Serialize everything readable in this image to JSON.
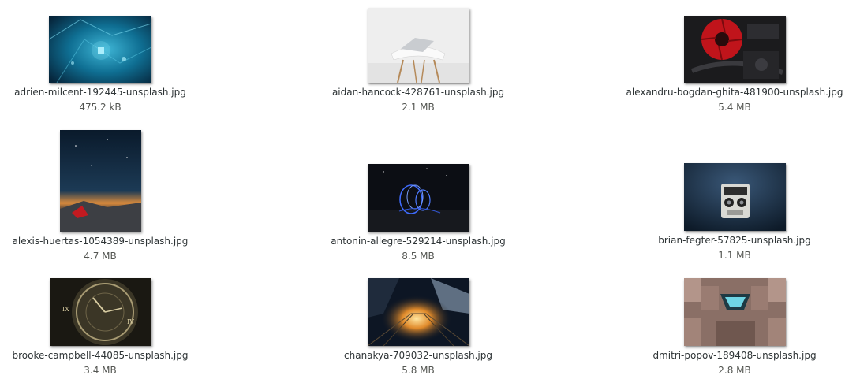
{
  "files": [
    {
      "name": "adrien-milcent-192445-unsplash.jpg",
      "size": "475.2 kB"
    },
    {
      "name": "aidan-hancock-428761-unsplash.jpg",
      "size": "2.1 MB"
    },
    {
      "name": "alexandru-bogdan-ghita-481900-unsplash.jpg",
      "size": "5.4 MB"
    },
    {
      "name": "alexis-huertas-1054389-unsplash.jpg",
      "size": "4.7 MB"
    },
    {
      "name": "antonin-allegre-529214-unsplash.jpg",
      "size": "8.5 MB"
    },
    {
      "name": "brian-fegter-57825-unsplash.jpg",
      "size": "1.1 MB"
    },
    {
      "name": "brooke-campbell-44085-unsplash.jpg",
      "size": "3.4 MB"
    },
    {
      "name": "chanakya-709032-unsplash.jpg",
      "size": "5.8 MB"
    },
    {
      "name": "dmitri-popov-189408-unsplash.jpg",
      "size": "2.8 MB"
    }
  ]
}
